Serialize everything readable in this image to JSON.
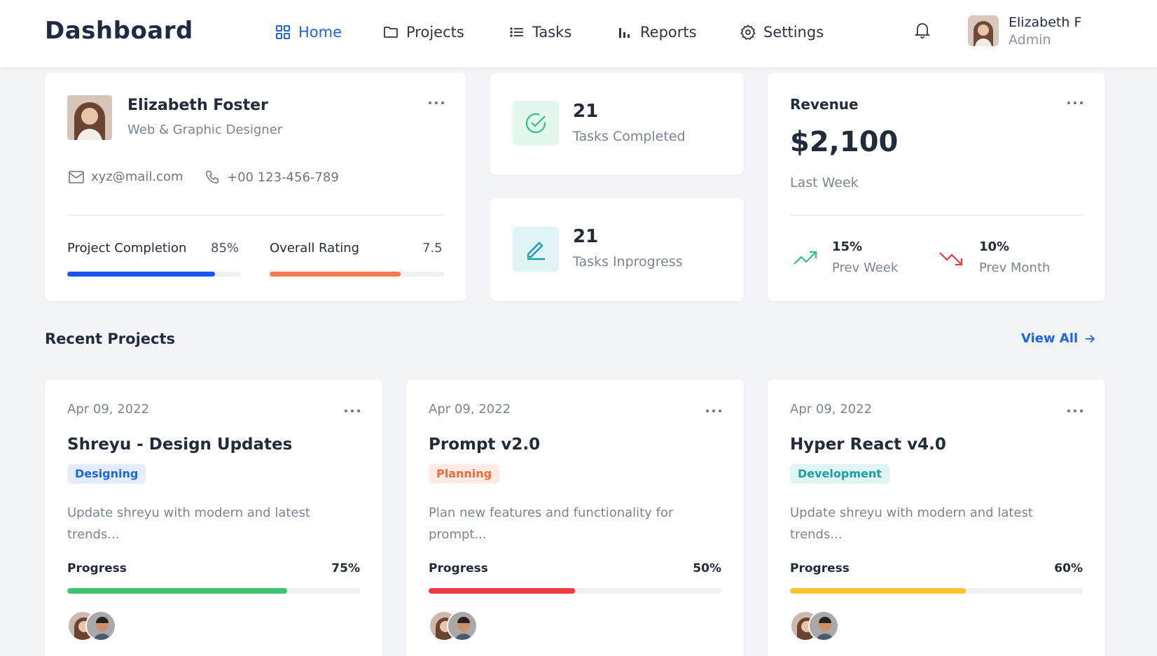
{
  "header": {
    "brand": "Dashboard",
    "nav": [
      {
        "label": "Home",
        "icon": "grid-icon",
        "active": true
      },
      {
        "label": "Projects",
        "icon": "folder-icon"
      },
      {
        "label": "Tasks",
        "icon": "list-icon"
      },
      {
        "label": "Reports",
        "icon": "bar-chart-icon"
      },
      {
        "label": "Settings",
        "icon": "gear-icon"
      }
    ],
    "user": {
      "name": "Elizabeth F",
      "role": "Admin"
    }
  },
  "profile": {
    "name": "Elizabeth Foster",
    "role": "Web & Graphic Designer",
    "email": "xyz@mail.com",
    "phone": "+00 123-456-789",
    "project_completion": {
      "label": "Project Completion",
      "value": "85%",
      "percent": 85
    },
    "overall_rating": {
      "label": "Overall Rating",
      "value": "7.5",
      "percent": 75
    }
  },
  "stats": {
    "completed": {
      "value": "21",
      "label": "Tasks Completed"
    },
    "inprogress": {
      "value": "21",
      "label": "Tasks Inprogress"
    }
  },
  "revenue": {
    "title": "Revenue",
    "amount": "$2,100",
    "period": "Last Week",
    "prev_week": {
      "value": "15%",
      "label": "Prev Week",
      "direction": "up"
    },
    "prev_month": {
      "value": "10%",
      "label": "Prev Month",
      "direction": "down"
    }
  },
  "recent": {
    "title": "Recent Projects",
    "view_all": "View All",
    "projects": [
      {
        "date": "Apr 09, 2022",
        "title": "Shreyu - Design Updates",
        "badge": "Designing",
        "badge_color": "#1d63e8",
        "badge_bg": "#e3edfd",
        "desc": "Update shreyu with modern and latest trends...",
        "progress_label": "Progress",
        "progress": "75%",
        "percent": 75,
        "bar_color": "#3dc46e"
      },
      {
        "date": "Apr 09, 2022",
        "title": "Prompt v2.0",
        "badge": "Planning",
        "badge_color": "#f4693a",
        "badge_bg": "#fdece5",
        "desc": "Plan new features and functionality for prompt...",
        "progress_label": "Progress",
        "progress": "50%",
        "percent": 50,
        "bar_color": "#ef3a41"
      },
      {
        "date": "Apr 09, 2022",
        "title": "Hyper React v4.0",
        "badge": "Development",
        "badge_color": "#189fa7",
        "badge_bg": "#e0f4f4",
        "desc": "Update shreyu with modern and latest trends...",
        "progress_label": "Progress",
        "progress": "60%",
        "percent": 60,
        "bar_color": "#f8c32d"
      }
    ]
  },
  "colors": {
    "accent": "#1d63e8",
    "completion_bar": "#1554ee",
    "rating_bar": "#f97a4c",
    "trend_up": "#2cc57a",
    "trend_down": "#ef3a41"
  }
}
